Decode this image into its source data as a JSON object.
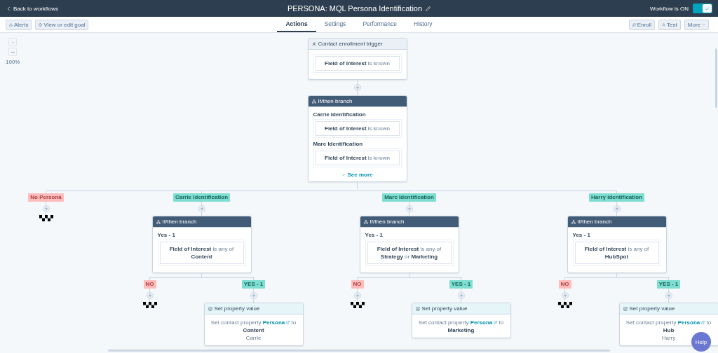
{
  "header": {
    "back_link": "Back to workflows",
    "title": "PERSONA: MQL Persona Identification",
    "status_label": "Workflow is ON",
    "status_on": true
  },
  "toolbar": {
    "left_buttons": [
      {
        "kind": "alerts",
        "label": "Alerts"
      },
      {
        "kind": "goal",
        "label": "View or edit goal"
      }
    ],
    "tabs": [
      {
        "label": "Actions",
        "selected": true
      },
      {
        "label": "Settings",
        "selected": false
      },
      {
        "label": "Performance",
        "selected": false
      },
      {
        "label": "History",
        "selected": false
      }
    ],
    "right_buttons": [
      {
        "kind": "enroll",
        "label": "Enroll"
      },
      {
        "kind": "test",
        "label": "Test"
      },
      {
        "kind": "more",
        "label": "More"
      }
    ]
  },
  "zoom": {
    "zoom_in_disabled": true,
    "level_text": "100%"
  },
  "trigger": {
    "kind": "trigger",
    "title": "Contact enrollment trigger",
    "conditions": [
      {
        "condition": "**Field of Interest** is known"
      }
    ]
  },
  "root_branch": {
    "kind": "branch",
    "title": "If/then branch",
    "conditions": [
      {
        "group": "Carrie Identification",
        "condition": "**Field of Interest** is known"
      },
      {
        "group": "Marc Identification",
        "condition": "**Field of Interest** is known"
      }
    ],
    "see_more": "See more",
    "branches": [
      {
        "label": "No Persona",
        "color": "#ffbcbc"
      },
      {
        "label": "Carrie Identification",
        "color": "#7fded1",
        "node": {
          "kind": "branch",
          "title": "If/then branch",
          "conditions": [
            {
              "group": "Yes - 1",
              "condition": "**Field of Interest** is any of **Content**"
            }
          ],
          "branches": [
            {
              "label": "NO",
              "color": "#ffbcbc"
            },
            {
              "label": "YES - 1",
              "color": "#7fded1",
              "node": {
                "kind": "action",
                "title": "Set property value",
                "text": "Set contact property",
                "link": "Persona",
                "rest": "to **Content**\nCarrie"
              }
            }
          ]
        }
      },
      {
        "label": "Marc Identification",
        "color": "#7fded1",
        "node": {
          "kind": "branch",
          "title": "If/then branch",
          "conditions": [
            {
              "group": "Yes - 1",
              "condition": "**Field of Interest** is any of **Strategy** or **Marketing**"
            }
          ],
          "branches": [
            {
              "label": "NO",
              "color": "#ffbcbc"
            },
            {
              "label": "YES - 1",
              "color": "#7fded1",
              "node": {
                "kind": "action",
                "title": "Set property value",
                "text": "Set contact property",
                "link": "Persona",
                "rest": "to **Marketing**"
              }
            }
          ]
        }
      },
      {
        "label": "Harry Identification",
        "color": "#7fded1",
        "node": {
          "kind": "branch",
          "title": "If/then branch",
          "conditions": [
            {
              "group": "Yes - 1",
              "condition": "**Field of Interest** is any of **HubSpot**"
            }
          ],
          "branches": [
            {
              "label": "NO",
              "color": "#ffbcbc"
            },
            {
              "label": "YES - 1",
              "color": "#7fded1",
              "node": {
                "kind": "action",
                "title": "Set property value",
                "text": "Set contact property",
                "link": "Persona",
                "rest": "to **Hub**\nHarry"
              }
            }
          ]
        }
      }
    ]
  },
  "help_button": "Help"
}
